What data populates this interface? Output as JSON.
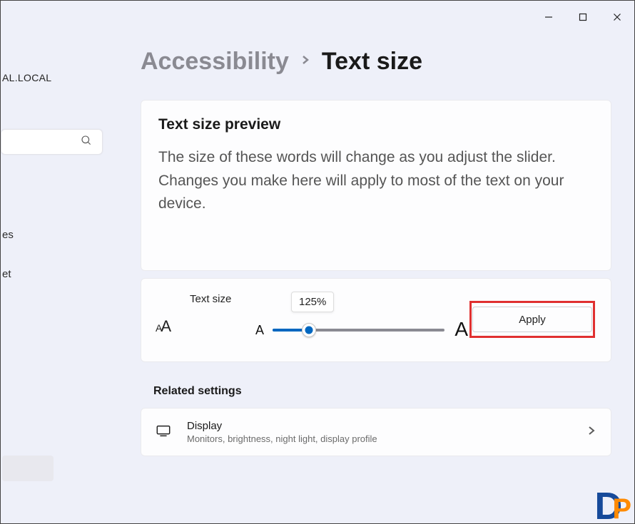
{
  "titlebar": {
    "min_icon": "minimize",
    "max_icon": "maximize",
    "close_icon": "close"
  },
  "sidebar": {
    "domain_label": "AL.LOCAL",
    "nav_frag_1": "es",
    "nav_frag_2": "et"
  },
  "breadcrumb": {
    "parent": "Accessibility",
    "current": "Text size"
  },
  "preview": {
    "title": "Text size preview",
    "body": "The size of these words will change as you adjust the slider. Changes you make here will apply to most of the text on your device."
  },
  "slider": {
    "label": "Text size",
    "value_label": "125%",
    "fill_percent": 21,
    "min_glyph": "A",
    "max_glyph": "A",
    "apply_label": "Apply"
  },
  "related": {
    "section_title": "Related settings",
    "display": {
      "title": "Display",
      "subtitle": "Monitors, brightness, night light, display profile"
    }
  },
  "watermark": {
    "d": "D",
    "p": "P"
  }
}
